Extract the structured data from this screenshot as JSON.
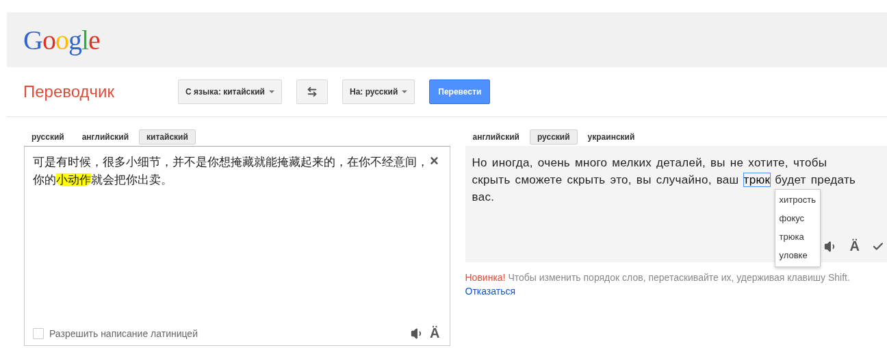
{
  "logo": "Google",
  "app_title": "Переводчик",
  "source_language_select": {
    "label": "С языка:  китайский"
  },
  "target_language_select": {
    "label": "На:  русский"
  },
  "translate_button": "Перевести",
  "source_tabs": [
    {
      "label": "русский",
      "selected": false
    },
    {
      "label": "английский",
      "selected": false
    },
    {
      "label": "китайский",
      "selected": true
    }
  ],
  "source_text": [
    {
      "text": "可是有时候，很多小细节，并不是你想掩藏就能掩藏起来的，在你不经意间，你的",
      "highlighted": false
    },
    {
      "text": "小动作",
      "highlighted": true
    },
    {
      "text": "就会把你出卖。",
      "highlighted": false
    }
  ],
  "clear_button": "×",
  "transliteration": {
    "label": "Разрешить написание латиницей",
    "checked": false
  },
  "source_keyboard_button": "Ä",
  "target_tabs": [
    {
      "label": "английский",
      "selected": false
    },
    {
      "label": "русский",
      "selected": true
    },
    {
      "label": "украинский",
      "selected": false
    }
  ],
  "translation": [
    {
      "text": "Но иногда, очень много мелких деталей, вы не хотите, чтобы скрыть сможете скрыть это, вы случайно, ваш ",
      "selected": false
    },
    {
      "text": "трюк",
      "selected": true
    },
    {
      "text": " будет предать вас.",
      "selected": false
    }
  ],
  "alternatives": [
    "хитрость",
    "фокус",
    "трюка",
    "уловке"
  ],
  "target_keyboard_button": "Ä",
  "notice": {
    "badge": "Новинка!",
    "text": "Чтобы изменить порядок слов, перетаскивайте их, удерживая клавишу Shift.",
    "link": "Отказаться"
  }
}
